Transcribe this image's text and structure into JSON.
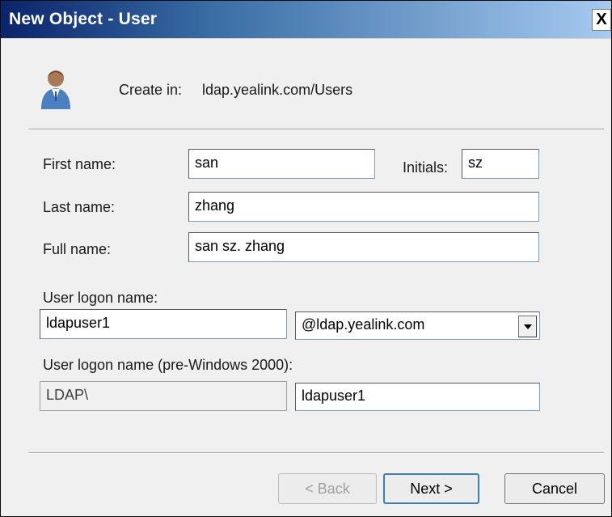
{
  "window": {
    "title": "New Object - User",
    "close_glyph": "X"
  },
  "header": {
    "icon": "user-icon",
    "create_in_label": "Create in:",
    "create_in_path": "ldap.yealink.com/Users"
  },
  "form": {
    "first_name_label": "First name:",
    "first_name_value": "san",
    "initials_label": "Initials:",
    "initials_value": "sz",
    "last_name_label": "Last name:",
    "last_name_value": "zhang",
    "full_name_label": "Full name:",
    "full_name_value": "san sz. zhang",
    "logon_name_label": "User logon name:",
    "logon_name_value": "ldapuser1",
    "domain_value": "@ldap.yealink.com",
    "pre2000_label": "User logon name (pre-Windows 2000):",
    "pre2000_domain_value": "LDAP\\",
    "pre2000_name_value": "ldapuser1"
  },
  "buttons": {
    "back": "< Back",
    "next": "Next >",
    "cancel": "Cancel"
  }
}
